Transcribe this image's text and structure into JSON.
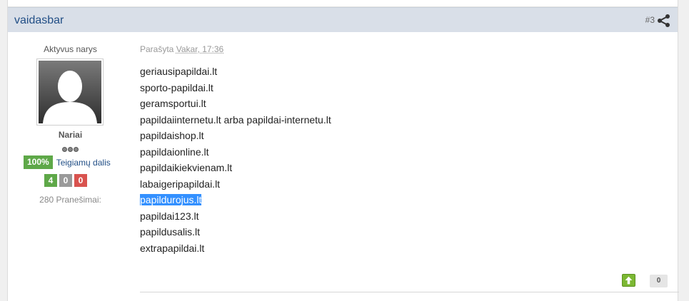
{
  "post": {
    "author": "vaidasbar",
    "number": "#3",
    "posted_prefix": "Parašyta",
    "posted_date": "Vakar, 17:36",
    "lines": [
      {
        "text": "geriausipapildai.lt"
      },
      {
        "text": "sporto-papildai.lt"
      },
      {
        "text": "geramsportui.lt"
      },
      {
        "text": "papildaiinternetu.lt arba papildai-internetu.lt"
      },
      {
        "text": "papildaishop.lt"
      },
      {
        "text": "papildaionline.lt"
      },
      {
        "text": "papildaikiekvienam.lt"
      },
      {
        "text": "labaigeripapildai.lt"
      },
      {
        "text": "papildurojus.lt"
      },
      {
        "text": "papildai123.lt"
      },
      {
        "text": "papildusalis.lt"
      },
      {
        "text": "extrapapildai.lt"
      }
    ],
    "score": "0"
  },
  "author_info": {
    "member_title": "Aktyvus narys",
    "group": "Nariai",
    "reputation_percent": "100%",
    "reputation_label": "Teigiamų dalis",
    "votes": {
      "positive": "4",
      "neutral": "0",
      "negative": "0"
    },
    "posts_count": "280 Pranešimai:"
  },
  "icons": {
    "share": "share-icon",
    "upvote": "upvote-arrow-icon"
  },
  "colors": {
    "accent": "#224f86",
    "header_bg": "#d9dfe8",
    "positive": "#5ea848",
    "negative": "#d9534f",
    "selection": "#3390ff"
  }
}
